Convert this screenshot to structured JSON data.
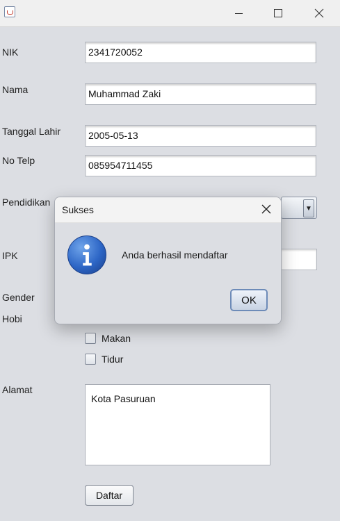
{
  "window": {
    "title": "",
    "icons": {
      "app": "java-cup-icon",
      "minimize": "minimize-icon",
      "maximize": "maximize-icon",
      "close": "close-icon"
    }
  },
  "form": {
    "nik_label": "NIK",
    "nik_value": "2341720052",
    "nama_label": "Nama",
    "nama_value": "Muhammad Zaki",
    "tanggal_label": "Tanggal Lahir",
    "tanggal_value": "2005-05-13",
    "telp_label": "No Telp",
    "telp_value": "085954711455",
    "pendidikan_label": "Pendidikan",
    "ipk_label": "IPK",
    "gender_label": "Gender",
    "hobi_label": "Hobi",
    "hobi_options": [
      "Makan",
      "Tidur"
    ],
    "alamat_label": "Alamat",
    "alamat_value": "Kota Pasuruan",
    "daftar_label": "Daftar"
  },
  "dialog": {
    "title": "Sukses",
    "message": "Anda berhasil mendaftar",
    "ok_label": "OK",
    "icon": "info-icon"
  }
}
